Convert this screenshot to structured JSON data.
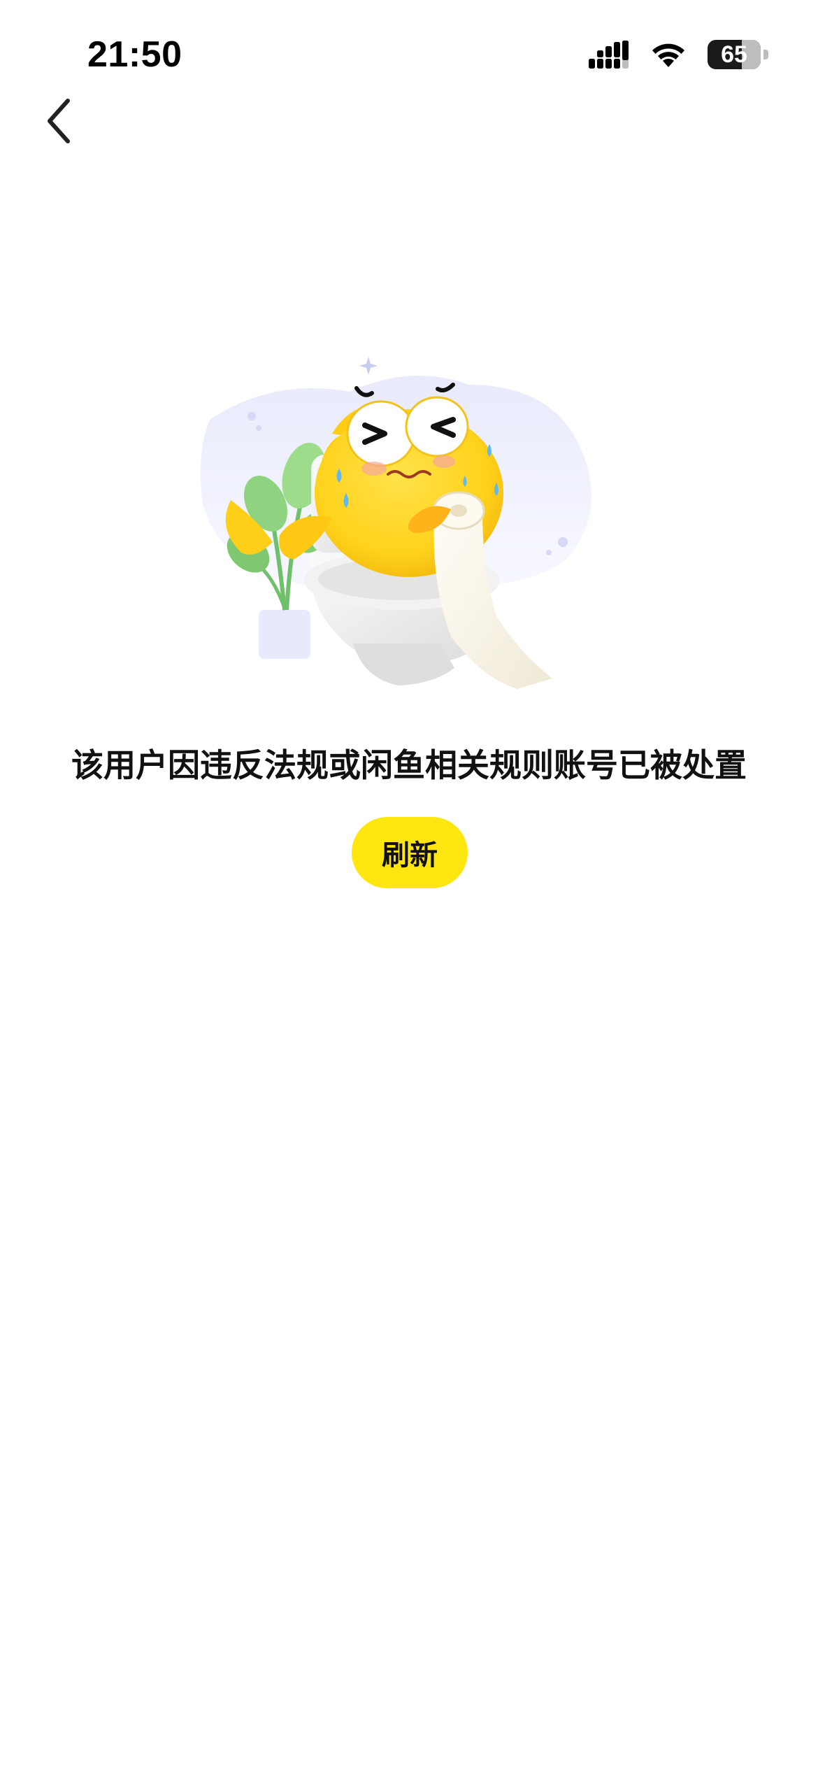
{
  "status_bar": {
    "time": "21:50",
    "battery_level": "65",
    "battery_fraction": 0.65,
    "icons": [
      "signal-icon",
      "wifi-icon",
      "battery-icon"
    ]
  },
  "nav": {
    "back_icon": "chevron-left-icon"
  },
  "main": {
    "illustration": "sad-fish-on-toilet-illustration",
    "message": "该用户因违反法规或闲鱼相关规则账号已被处置",
    "refresh_label": "刷新"
  },
  "colors": {
    "accent_yellow": "#ffe60f",
    "text_primary": "#111111",
    "background": "#ffffff"
  }
}
